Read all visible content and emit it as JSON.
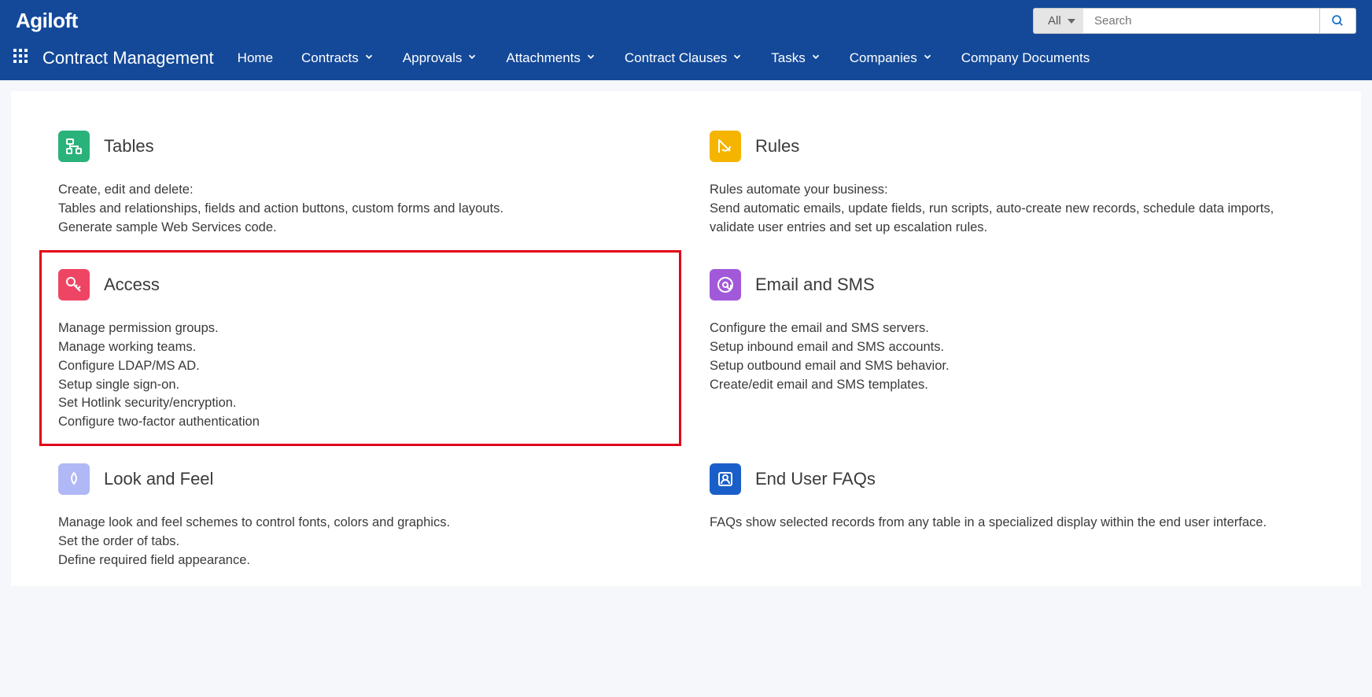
{
  "logo": "Agiloft",
  "search": {
    "filter": "All",
    "placeholder": "Search"
  },
  "nav": {
    "title": "Contract Management",
    "items": [
      {
        "label": "Home",
        "dropdown": false
      },
      {
        "label": "Contracts",
        "dropdown": true
      },
      {
        "label": "Approvals",
        "dropdown": true
      },
      {
        "label": "Attachments",
        "dropdown": true
      },
      {
        "label": "Contract Clauses",
        "dropdown": true
      },
      {
        "label": "Tasks",
        "dropdown": true
      },
      {
        "label": "Companies",
        "dropdown": true
      },
      {
        "label": "Company Documents",
        "dropdown": false
      }
    ]
  },
  "cards": {
    "tables": {
      "title": "Tables",
      "lines": [
        "Create, edit and delete:",
        "Tables and relationships, fields and action buttons, custom forms and layouts.",
        "Generate sample Web Services code."
      ]
    },
    "rules": {
      "title": "Rules",
      "lines": [
        "Rules automate your business:",
        "Send automatic emails, update fields, run scripts, auto-create new records, schedule data imports, validate user entries and set up escalation rules."
      ]
    },
    "access": {
      "title": "Access",
      "lines": [
        "Manage permission groups.",
        "Manage working teams.",
        "Configure LDAP/MS AD.",
        "Setup single sign-on.",
        "Set Hotlink security/encryption.",
        "Configure two-factor authentication"
      ]
    },
    "email": {
      "title": "Email and SMS",
      "lines": [
        "Configure the email and SMS servers.",
        "Setup inbound email and SMS accounts.",
        "Setup outbound email and SMS behavior.",
        "Create/edit email and SMS templates."
      ]
    },
    "look": {
      "title": "Look and Feel",
      "lines": [
        "Manage look and feel schemes to control fonts, colors and graphics.",
        "Set the order of tabs.",
        "Define required field appearance."
      ]
    },
    "faq": {
      "title": "End User FAQs",
      "lines": [
        "FAQs show selected records from any table in a specialized display within the end user interface."
      ]
    }
  }
}
